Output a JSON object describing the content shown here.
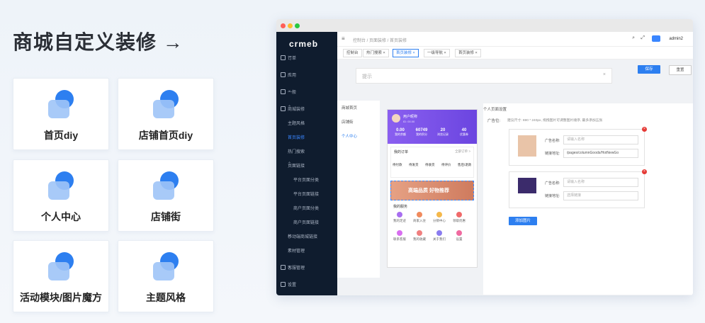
{
  "heading": "商城自定义装修 →",
  "cards": [
    {
      "label": "首页diy",
      "icon": "home-icon"
    },
    {
      "label": "店铺首页diy",
      "icon": "shop-window-icon"
    },
    {
      "label": "个人中心",
      "icon": "user-icon"
    },
    {
      "label": "店铺街",
      "icon": "store-street-icon"
    },
    {
      "label": "活动模块/图片魔方",
      "icon": "ribbon-star-icon"
    },
    {
      "label": "主题风格",
      "icon": "palette-icon"
    }
  ],
  "app": {
    "logo": "crmeb",
    "sidebar": [
      {
        "label": "订单",
        "level": 0
      },
      {
        "label": "应用",
        "level": 0
      },
      {
        "label": "一般",
        "level": 0
      },
      {
        "label": "商城装修",
        "level": 0
      },
      {
        "label": "主题风格",
        "level": 1
      },
      {
        "label": "首页装修",
        "level": 1,
        "active": true
      },
      {
        "label": "热门搜索",
        "level": 1
      },
      {
        "label": "页面链接",
        "level": 1
      },
      {
        "label": "平台页面分类",
        "level": 2
      },
      {
        "label": "平台页面链接",
        "level": 2
      },
      {
        "label": "商户页面分类",
        "level": 2
      },
      {
        "label": "商户页面链接",
        "level": 2
      },
      {
        "label": "移动端商城链接",
        "level": 1
      },
      {
        "label": "素材管理",
        "level": 1
      },
      {
        "label": "客服管理",
        "level": 0
      },
      {
        "label": "设置",
        "level": 0
      }
    ],
    "breadcrumb": "控制台 / 页面装修 / 首页装修",
    "user": "admin2",
    "tabs": [
      {
        "label": "控制台",
        "on": false
      },
      {
        "label": "热门搜索 ×",
        "on": false
      },
      {
        "label": "首页装修 ×",
        "on": true
      },
      {
        "label": "一级导航 ×",
        "on": false
      },
      {
        "label": "首页装修 ×",
        "on": false
      }
    ],
    "hint": "提示",
    "save_label": "保存",
    "reset_label": "重置",
    "left_tabs": [
      "商城首页",
      "店铺街",
      "个人中心"
    ],
    "phone": {
      "user_name": "用户昵称",
      "user_id": "ID: 00.00",
      "stats": [
        {
          "value": "0.00",
          "label": "我的余额"
        },
        {
          "value": "60749",
          "label": "我的积分"
        },
        {
          "value": "20",
          "label": "浏览记录"
        },
        {
          "value": "40",
          "label": "优惠券"
        }
      ],
      "orders_title": "我的订单",
      "orders_all": "全部订单 >",
      "orders": [
        "待付款",
        "待发货",
        "待收货",
        "待评价",
        "售后/退款"
      ],
      "banner": "高端品质 好物推荐",
      "services_title": "我的服务",
      "services": [
        "我的足迹",
        "商家入驻",
        "分销中心",
        "领取优惠",
        "联系客服",
        "我的收藏",
        "关于我们",
        "设置"
      ]
    },
    "settings_title": "个人页面设置",
    "ad_label": "广告位:",
    "ad_tip": "建议尺寸: 690 * 240px, 拖拽图片可调整图片顺序, 最多添加五张",
    "ads": [
      {
        "name_label": "广告名称:",
        "name_placeholder": "请输入名称",
        "link_label": "链接地址:",
        "link_value": "/pages/columnGoods/HotNewGo",
        "thumb_color": "#e9c4a8"
      },
      {
        "name_label": "广告名称:",
        "name_placeholder": "请输入名称",
        "link_label": "链接地址:",
        "link_value": "选择链接",
        "thumb_color": "#3b2b6b"
      }
    ],
    "add_ad_label": "添加图片"
  }
}
